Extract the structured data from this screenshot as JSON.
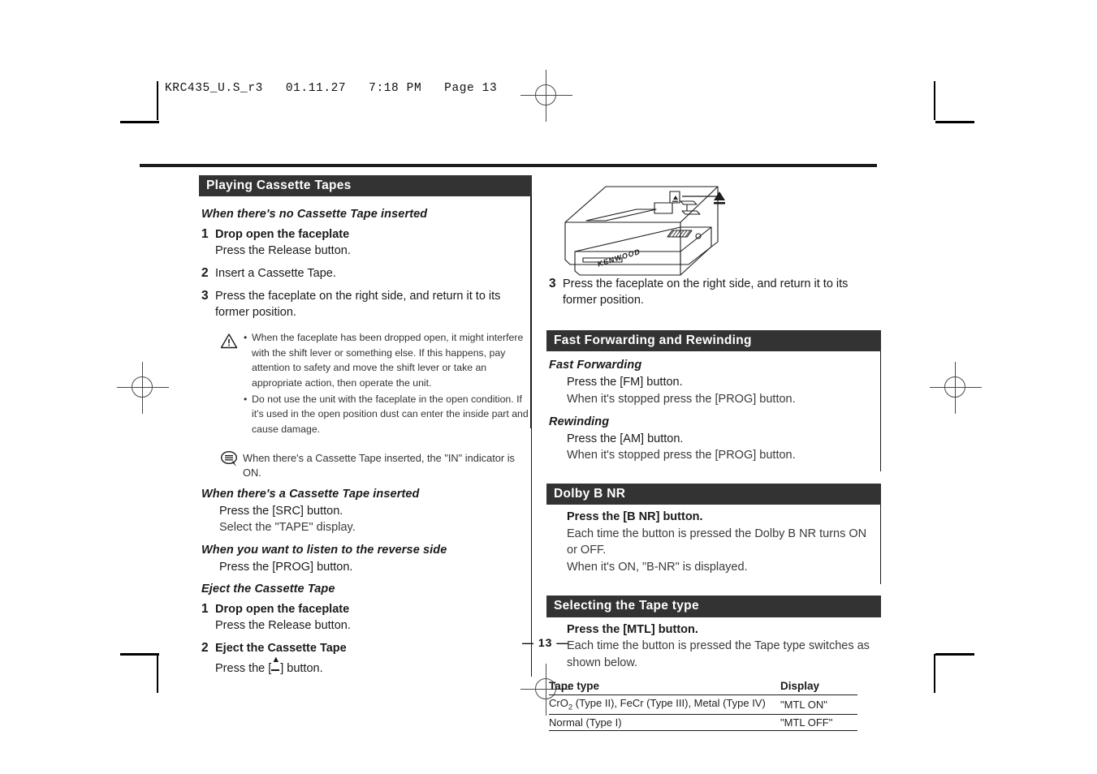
{
  "file_header": "KRC435_U.S_r3   01.11.27   7:18 PM   Page 13",
  "page_number": "— 13 —",
  "left_column": {
    "section_title": "Playing Cassette Tapes",
    "sub1_title": "When there's no Cassette Tape inserted",
    "steps1": [
      {
        "num": "1",
        "title": "Drop open the faceplate",
        "detail": "Press the Release button."
      },
      {
        "num": "2",
        "title": "Insert a Cassette Tape.",
        "detail": ""
      },
      {
        "num": "3",
        "title": "Press the faceplate on the right side, and return it to its former position.",
        "detail": ""
      }
    ],
    "caution_icon": "warning-triangle-icon",
    "caution_items": [
      "When the faceplate has been dropped open, it might interfere with the shift lever or something else. If this happens, pay attention to safety and move the shift lever or take an appropriate action, then operate the unit.",
      "Do not use the unit with the faceplate in the open condition. If it's used in the open position dust can enter the inside part and cause damage."
    ],
    "tip_icon": "note-bubble-icon",
    "tip_text": "When there's a Cassette Tape inserted, the \"IN\" indicator is ON.",
    "sub2_title": "When there's a Cassette Tape inserted",
    "sub2_lines": [
      "Press the [SRC] button.",
      "Select the \"TAPE\" display."
    ],
    "sub3_title": "When you want to listen to the reverse side",
    "sub3_lines": [
      "Press the [PROG] button."
    ],
    "sub4_title": "Eject the Cassette Tape",
    "steps2": [
      {
        "num": "1",
        "title": "Drop open the faceplate",
        "detail": "Press the Release button."
      },
      {
        "num": "2",
        "title": "Eject the Cassette Tape",
        "detail_prefix": "Press the [",
        "detail_suffix": "] button."
      }
    ]
  },
  "right_column": {
    "illustration_name": "faceplate-eject-illustration",
    "illustration_brand": "KENWOOD",
    "step3": {
      "num": "3",
      "text": "Press the faceplate on the right side, and return it to its former position."
    },
    "section2_title": "Fast Forwarding and Rewinding",
    "ff_title": "Fast Forwarding",
    "ff_lines": [
      "Press the [FM] button.",
      "When it's stopped press the [PROG] button."
    ],
    "rw_title": "Rewinding",
    "rw_lines": [
      "Press the [AM] button.",
      "When it's stopped press the [PROG] button."
    ],
    "section3_title": "Dolby B NR",
    "dolby_lines": [
      "Press the [B NR] button.",
      "Each time the button is pressed the Dolby B NR turns ON or OFF.",
      "When it's ON, \"B-NR\" is displayed."
    ],
    "section4_title": "Selecting the Tape type",
    "tape_lines": [
      "Press the [MTL] button.",
      "Each time the button is pressed the Tape type switches as shown below."
    ],
    "table": {
      "headers": [
        "Tape type",
        "Display"
      ],
      "rows": [
        {
          "type_pre": "CrO",
          "type_sub": "2",
          "type_post": " (Type II), FeCr (Type III), Metal (Type IV)",
          "display": "\"MTL ON\""
        },
        {
          "type_pre": "Normal (Type I)",
          "type_sub": "",
          "type_post": "",
          "display": "\"MTL OFF\""
        }
      ]
    }
  }
}
